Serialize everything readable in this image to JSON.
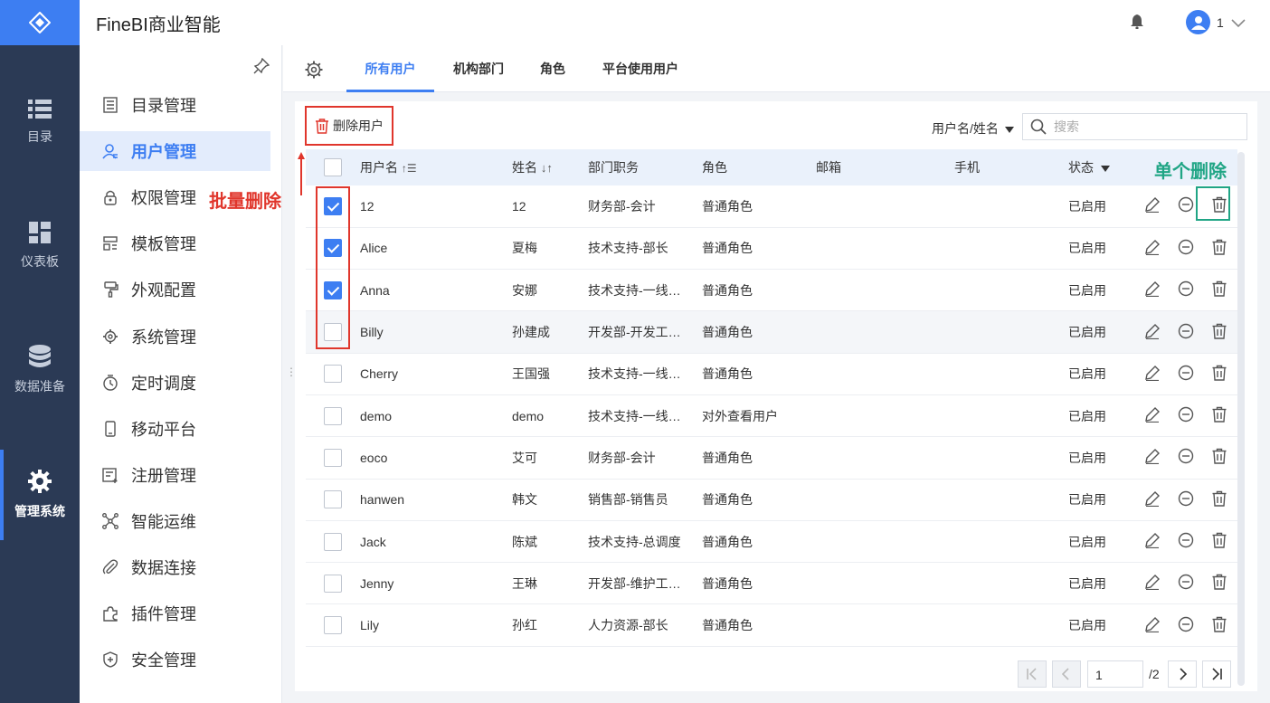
{
  "app": {
    "title": "FineBI商业智能",
    "user": "1"
  },
  "rail": [
    {
      "label": "目录",
      "icon": "list-icon"
    },
    {
      "label": "仪表板",
      "icon": "dashboard-icon"
    },
    {
      "label": "数据准备",
      "icon": "database-icon"
    },
    {
      "label": "管理系统",
      "icon": "gear-icon",
      "active": true
    }
  ],
  "menu": [
    {
      "label": "目录管理",
      "icon": "catalog-icon"
    },
    {
      "label": "用户管理",
      "icon": "user-icon",
      "active": true
    },
    {
      "label": "权限管理",
      "icon": "lock-icon"
    },
    {
      "label": "模板管理",
      "icon": "template-icon"
    },
    {
      "label": "外观配置",
      "icon": "paint-icon"
    },
    {
      "label": "系统管理",
      "icon": "settings-icon"
    },
    {
      "label": "定时调度",
      "icon": "timer-icon"
    },
    {
      "label": "移动平台",
      "icon": "mobile-icon"
    },
    {
      "label": "注册管理",
      "icon": "register-icon"
    },
    {
      "label": "智能运维",
      "icon": "network-icon"
    },
    {
      "label": "数据连接",
      "icon": "link-icon"
    },
    {
      "label": "插件管理",
      "icon": "plugin-icon"
    },
    {
      "label": "安全管理",
      "icon": "shield-icon"
    }
  ],
  "tabs": [
    {
      "label": "所有用户",
      "active": true
    },
    {
      "label": "机构部门"
    },
    {
      "label": "角色"
    },
    {
      "label": "平台使用用户"
    }
  ],
  "toolbar": {
    "delete_label": "删除用户",
    "search_type": "用户名/姓名",
    "search_placeholder": "搜索"
  },
  "annotations": {
    "batch_delete": "批量删除",
    "single_delete": "单个删除"
  },
  "table": {
    "columns": [
      "用户名",
      "姓名",
      "部门职务",
      "角色",
      "邮箱",
      "手机",
      "状态"
    ],
    "rows": [
      {
        "checked": true,
        "username": "12",
        "name": "12",
        "dept": "财务部-会计",
        "role": "普通角色",
        "email": "",
        "phone": "",
        "status": "已启用"
      },
      {
        "checked": true,
        "username": "Alice",
        "name": "夏梅",
        "dept": "技术支持-部长",
        "role": "普通角色",
        "email": "",
        "phone": "",
        "status": "已启用"
      },
      {
        "checked": true,
        "username": "Anna",
        "name": "安娜",
        "dept": "技术支持-一线…",
        "role": "普通角色",
        "email": "",
        "phone": "",
        "status": "已启用"
      },
      {
        "checked": false,
        "username": "Billy",
        "name": "孙建成",
        "dept": "开发部-开发工…",
        "role": "普通角色",
        "email": "",
        "phone": "",
        "status": "已启用",
        "hover": true
      },
      {
        "checked": false,
        "username": "Cherry",
        "name": "王国强",
        "dept": "技术支持-一线…",
        "role": "普通角色",
        "email": "",
        "phone": "",
        "status": "已启用"
      },
      {
        "checked": false,
        "username": "demo",
        "name": "demo",
        "dept": "技术支持-一线…",
        "role": "对外查看用户",
        "email": "",
        "phone": "",
        "status": "已启用"
      },
      {
        "checked": false,
        "username": "eoco",
        "name": "艾可",
        "dept": "财务部-会计",
        "role": "普通角色",
        "email": "",
        "phone": "",
        "status": "已启用"
      },
      {
        "checked": false,
        "username": "hanwen",
        "name": "韩文",
        "dept": "销售部-销售员",
        "role": "普通角色",
        "email": "",
        "phone": "",
        "status": "已启用"
      },
      {
        "checked": false,
        "username": "Jack",
        "name": "陈斌",
        "dept": "技术支持-总调度",
        "role": "普通角色",
        "email": "",
        "phone": "",
        "status": "已启用"
      },
      {
        "checked": false,
        "username": "Jenny",
        "name": "王琳",
        "dept": "开发部-维护工…",
        "role": "普通角色",
        "email": "",
        "phone": "",
        "status": "已启用"
      },
      {
        "checked": false,
        "username": "Lily",
        "name": "孙红",
        "dept": "人力资源-部长",
        "role": "普通角色",
        "email": "",
        "phone": "",
        "status": "已启用"
      }
    ]
  },
  "pagination": {
    "current": "1",
    "total": "/2"
  },
  "colors": {
    "accent": "#3d7ef2",
    "rail": "#2b3a55",
    "annot_red": "#e0362c",
    "annot_green": "#20a585"
  }
}
